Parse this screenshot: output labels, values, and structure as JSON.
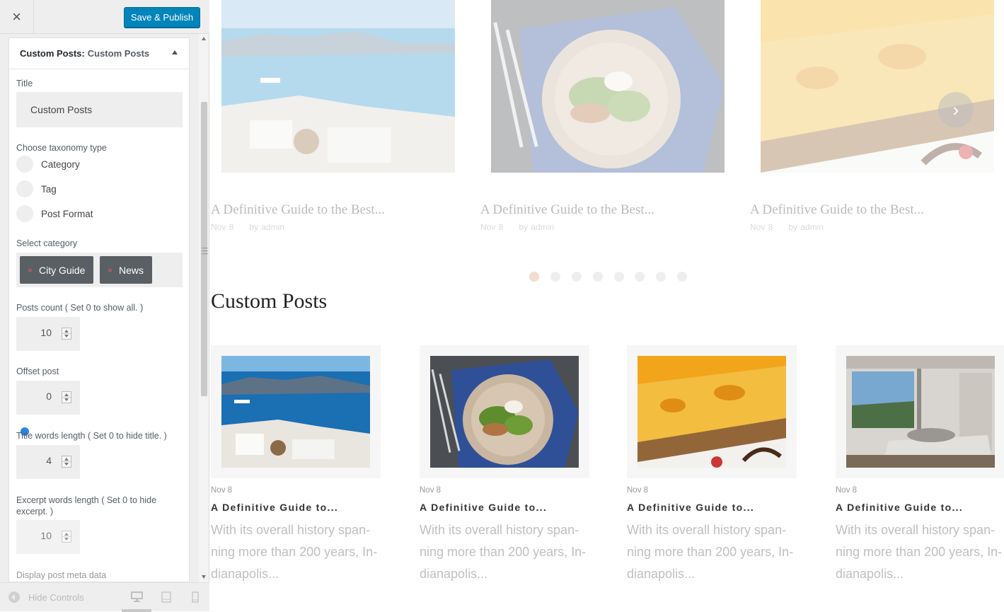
{
  "topbar": {
    "close_icon": "×",
    "publish_label": "Save & Publish"
  },
  "section": {
    "title_prefix": "Custom Posts:",
    "title_name": "Custom Posts"
  },
  "fields": {
    "title_label": "Title",
    "title_value": "Custom Posts",
    "taxonomy_label": "Choose taxonomy type",
    "taxonomy_options": [
      {
        "label": "Category",
        "checked": true
      },
      {
        "label": "Tag",
        "checked": false
      },
      {
        "label": "Post Format",
        "checked": false
      }
    ],
    "category_label": "Select category",
    "selected_categories": [
      "City Guide",
      "News"
    ],
    "chip_remove_icon": "×",
    "posts_count_label": "Posts count ( Set 0 to show all. )",
    "posts_count_value": "10",
    "offset_label": "Offset post",
    "offset_value": "0",
    "title_words_label": "Title words length ( Set 0 to hide title. )",
    "title_words_value": "4",
    "excerpt_words_label": "Excerpt words length ( Set 0 to hide excerpt. )",
    "excerpt_words_value": "10",
    "display_meta_label": "Display post meta data"
  },
  "footer": {
    "hide_controls_label": "Hide Controls"
  },
  "preview": {
    "slider": [
      {
        "title": "A Definitive Guide to the Best...",
        "date": "Nov 8",
        "author": "by admin"
      },
      {
        "title": "A Definitive Guide to the Best...",
        "date": "Nov 8",
        "author": "by admin"
      },
      {
        "title": "A Definitive Guide to the Best...",
        "date": "Nov 8",
        "author": "by admin"
      }
    ],
    "next_icon": "›",
    "section_title": "Custom Posts",
    "cards": [
      {
        "date": "Nov 8",
        "title": "A Definitive Guide to...",
        "excerpt": "With its overall history span-ning more than 200 years, In-dianapolis..."
      },
      {
        "date": "Nov 8",
        "title": "A Definitive Guide to...",
        "excerpt": "With its overall history span-ning more than 200 years, In-dianapolis..."
      },
      {
        "date": "Nov 8",
        "title": "A Definitive Guide to...",
        "excerpt": "With its overall history span-ning more than 200 years, In-dianapolis..."
      },
      {
        "date": "Nov 8",
        "title": "A Definitive Guide to...",
        "excerpt": "With its overall history span-ning more than 200 years, In-dianapolis..."
      }
    ]
  },
  "colors": {
    "accent": "#0085ba",
    "radio_checked": "#2a86e6",
    "chip_bg": "#5a5f64",
    "chip_remove": "#e55555"
  }
}
